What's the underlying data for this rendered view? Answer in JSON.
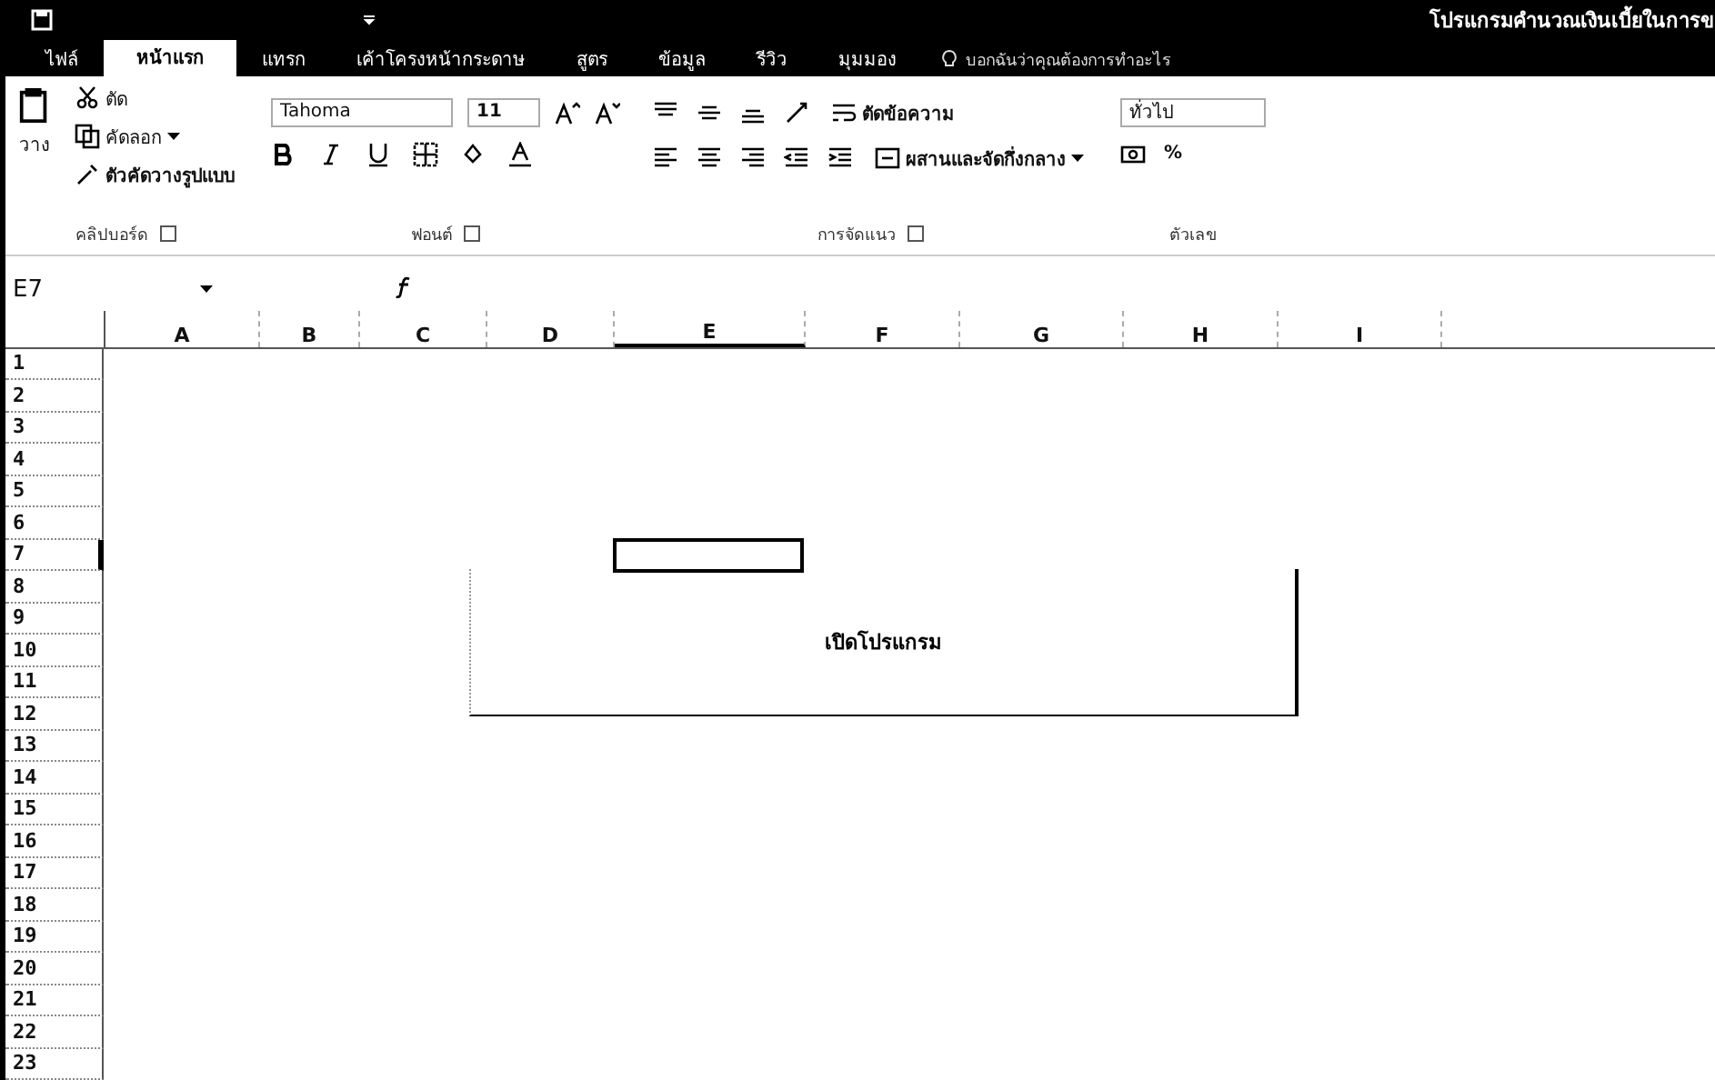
{
  "window": {
    "title": "โปรแกรมคำนวณเงินเบี้ยในการข"
  },
  "tabs": [
    {
      "label": "ไฟล์",
      "selected": false
    },
    {
      "label": "หน้าแรก",
      "selected": true
    },
    {
      "label": "แทรก",
      "selected": false
    },
    {
      "label": "เค้าโครงหน้ากระดาษ",
      "selected": false
    },
    {
      "label": "สูตร",
      "selected": false
    },
    {
      "label": "ข้อมูล",
      "selected": false
    },
    {
      "label": "รีวิว",
      "selected": false
    },
    {
      "label": "มุมมอง",
      "selected": false
    }
  ],
  "tell_me": {
    "placeholder": "บอกฉันว่าคุณต้องการทำอะไร"
  },
  "ribbon": {
    "clipboard": {
      "paste": "วาง",
      "cut": "ตัด",
      "copy": "คัดลอก",
      "format_painter": "ตัวคัดวางรูปแบบ",
      "label": "คลิปบอร์ด"
    },
    "font": {
      "name": "Tahoma",
      "size": "11",
      "label": "ฟอนต์"
    },
    "alignment": {
      "wrap": "ตัดข้อความ",
      "merge": "ผสานและจัดกึ่งกลาง",
      "label": "การจัดแนว"
    },
    "number": {
      "format": "ทั่วไป",
      "percent": "%",
      "label": "ตัวเลข"
    }
  },
  "name_box": "E7",
  "columns": [
    {
      "label": "A",
      "selected": false
    },
    {
      "label": "B",
      "selected": false
    },
    {
      "label": "C",
      "selected": false
    },
    {
      "label": "D",
      "selected": false
    },
    {
      "label": "E",
      "selected": true
    },
    {
      "label": "F",
      "selected": false
    },
    {
      "label": "G",
      "selected": false
    },
    {
      "label": "H",
      "selected": false
    },
    {
      "label": "I",
      "selected": false
    }
  ],
  "rows": [
    {
      "label": "1",
      "selected": false
    },
    {
      "label": "2",
      "selected": false
    },
    {
      "label": "3",
      "selected": false
    },
    {
      "label": "4",
      "selected": false
    },
    {
      "label": "5",
      "selected": false
    },
    {
      "label": "6",
      "selected": false
    },
    {
      "label": "7",
      "selected": true
    },
    {
      "label": "8",
      "selected": false
    },
    {
      "label": "9",
      "selected": false
    },
    {
      "label": "10",
      "selected": false
    },
    {
      "label": "11",
      "selected": false
    },
    {
      "label": "12",
      "selected": false
    },
    {
      "label": "13",
      "selected": false
    },
    {
      "label": "14",
      "selected": false
    },
    {
      "label": "15",
      "selected": false
    },
    {
      "label": "16",
      "selected": false
    },
    {
      "label": "17",
      "selected": false
    },
    {
      "label": "18",
      "selected": false
    },
    {
      "label": "19",
      "selected": false
    },
    {
      "label": "20",
      "selected": false
    },
    {
      "label": "21",
      "selected": false
    },
    {
      "label": "22",
      "selected": false
    },
    {
      "label": "23",
      "selected": false
    }
  ],
  "sheet_button": {
    "label": "เปิดโปรแกรม"
  }
}
